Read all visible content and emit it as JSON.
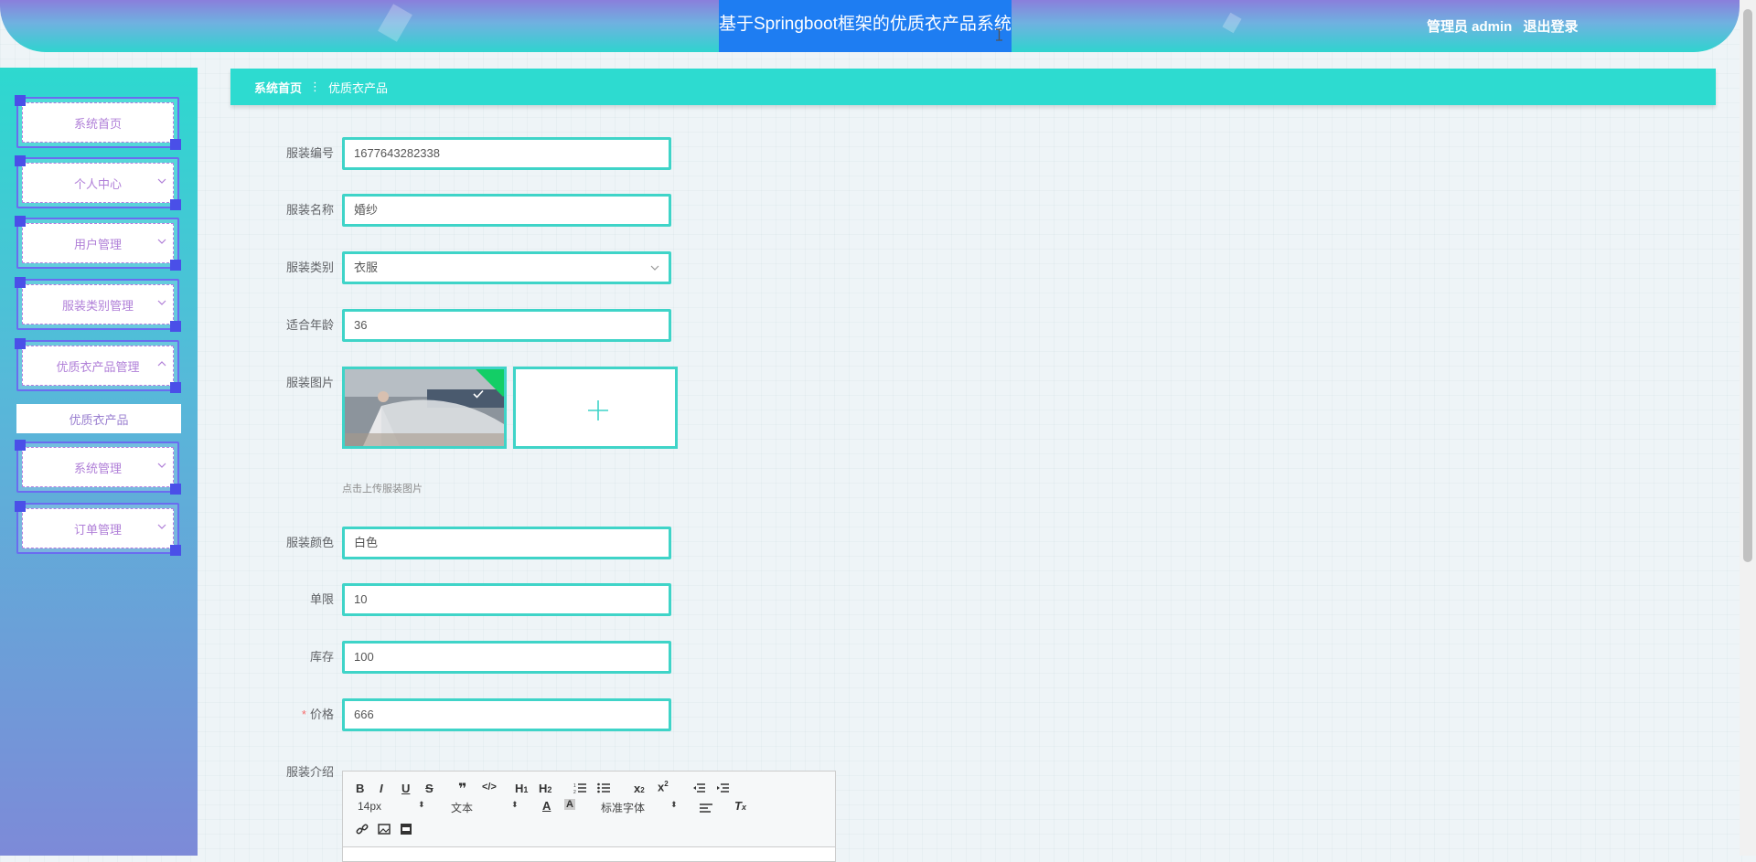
{
  "header": {
    "title": "基于Springboot框架的优质衣产品系统",
    "user_role": "管理员 admin",
    "logout": "退出登录"
  },
  "sidebar": {
    "items": [
      {
        "label": "系统首页",
        "has_arrow": false
      },
      {
        "label": "个人中心",
        "has_arrow": true
      },
      {
        "label": "用户管理",
        "has_arrow": true
      },
      {
        "label": "服装类别管理",
        "has_arrow": true
      },
      {
        "label": "优质衣产品管理",
        "has_arrow": true,
        "expanded": true
      },
      {
        "label": "系统管理",
        "has_arrow": true
      },
      {
        "label": "订单管理",
        "has_arrow": true
      }
    ],
    "submenu": "优质衣产品"
  },
  "breadcrumb": {
    "home": "系统首页",
    "separator": "⋮",
    "current": "优质衣产品"
  },
  "form": {
    "code": {
      "label": "服装编号",
      "value": "1677643282338"
    },
    "name": {
      "label": "服装名称",
      "value": "婚纱"
    },
    "category": {
      "label": "服装类别",
      "value": "衣服"
    },
    "age": {
      "label": "适合年龄",
      "value": "36"
    },
    "image": {
      "label": "服装图片",
      "tip": "点击上传服装图片"
    },
    "color": {
      "label": "服装颜色",
      "value": "白色"
    },
    "limit": {
      "label": "单限",
      "value": "10"
    },
    "stock": {
      "label": "库存",
      "value": "100"
    },
    "price": {
      "label": "价格",
      "required_mark": "*",
      "value": "666"
    },
    "intro": {
      "label": "服装介绍"
    }
  },
  "editor": {
    "font_size": "14px",
    "header_type": "文本",
    "font_family": "标准字体"
  },
  "colors": {
    "accent": "#3fd4c8",
    "breadcrumb_bg": "#2ddbd0",
    "title_highlight": "#1e7df2"
  }
}
